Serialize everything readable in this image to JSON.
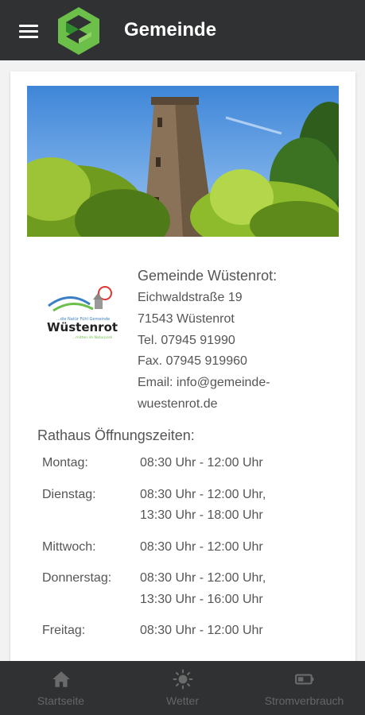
{
  "header": {
    "title": "Gemeinde",
    "menu_icon": "hamburger-menu-icon",
    "logo_colors": {
      "light": "#6cc04a",
      "dark": "#2e8b2e",
      "mid": "#4caf50"
    }
  },
  "hero_image": {
    "description_icon": "wooden-tower-photo"
  },
  "municipality_logo": {
    "tagline": "...die Natür Fühl Gemeinde",
    "name": "Wüstenrot",
    "subline": "...mitten im Naturpark"
  },
  "contact": {
    "heading": "Gemeinde Wüstenrot:",
    "street": "Eichwaldstraße 19",
    "city": "71543 Wüstenrot",
    "phone": "Tel. 07945 91990",
    "fax": "Fax. 07945 919960",
    "email_line1": "Email: info@gemeinde-",
    "email_line2": "wuestenrot.de"
  },
  "hours": {
    "title": "Rathaus Öffnungszeiten:",
    "rows": [
      {
        "day": "Montag:",
        "time": "08:30 Uhr - 12:00 Uhr"
      },
      {
        "day": "Dienstag:",
        "time": "08:30 Uhr - 12:00 Uhr,\n13:30 Uhr - 18:00 Uhr"
      },
      {
        "day": "Mittwoch:",
        "time": "08:30 Uhr - 12:00 Uhr"
      },
      {
        "day": "Donnerstag:",
        "time": "08:30 Uhr - 12:00 Uhr,\n13:30 Uhr - 16:00 Uhr"
      },
      {
        "day": "Freitag:",
        "time": "08:30 Uhr - 12:00 Uhr"
      }
    ]
  },
  "bottom_nav": {
    "items": [
      {
        "label": "Startseite",
        "icon": "home-icon"
      },
      {
        "label": "Wetter",
        "icon": "sun-icon"
      },
      {
        "label": "Stromverbrauch",
        "icon": "battery-icon"
      }
    ]
  }
}
